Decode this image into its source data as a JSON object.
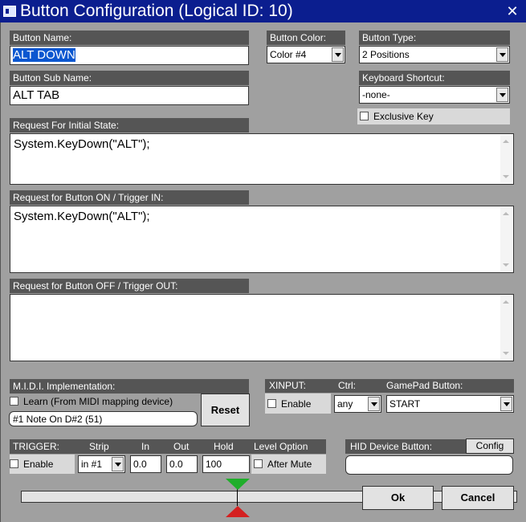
{
  "window": {
    "title": "Button Configuration (Logical ID: 10)"
  },
  "button_name": {
    "label": "Button Name:",
    "value": "ALT DOWN"
  },
  "button_sub_name": {
    "label": "Button Sub Name:",
    "value": "ALT TAB"
  },
  "button_color": {
    "label": "Button Color:",
    "value": "Color #4"
  },
  "button_type": {
    "label": "Button Type:",
    "value": "2 Positions"
  },
  "keyboard_shortcut": {
    "label": "Keyboard Shortcut:",
    "value": "-none-"
  },
  "exclusive_key": {
    "label": "Exclusive Key",
    "checked": false
  },
  "initial_state": {
    "label": "Request For Initial State:",
    "value": "System.KeyDown(\"ALT\");"
  },
  "button_on": {
    "label": "Request for Button ON / Trigger IN:",
    "value": "System.KeyDown(\"ALT\");"
  },
  "button_off": {
    "label": "Request for Button OFF / Trigger OUT:",
    "value": ""
  },
  "midi": {
    "label": "M.I.D.I. Implementation:",
    "learn_label": "Learn (From MIDI mapping device)",
    "learn_checked": false,
    "mapping_value": "#1 Note On D#2 (51)",
    "reset_label": "Reset"
  },
  "xinput": {
    "label": "XINPUT:",
    "ctrl_label": "Ctrl:",
    "gamepad_label": "GamePad Button:",
    "enable_label": "Enable",
    "enable_checked": false,
    "ctrl_value": "any",
    "gamepad_value": "START"
  },
  "trigger": {
    "label": "TRIGGER:",
    "strip_label": "Strip",
    "in_label": "In",
    "out_label": "Out",
    "hold_label": "Hold",
    "level_label": "Level Option",
    "enable_label": "Enable",
    "enable_checked": false,
    "strip_value": "in #1",
    "in_value": "0.0",
    "out_value": "0.0",
    "hold_value": "100",
    "after_mute_label": "After Mute",
    "after_mute_checked": false,
    "level_marker": 0.437,
    "colors": {
      "top_marker": "#1fae2a",
      "bottom_marker": "#d42020"
    }
  },
  "hid": {
    "label": "HID Device Button:",
    "config_label": "Config",
    "value": ""
  },
  "actions": {
    "ok_label": "Ok",
    "cancel_label": "Cancel"
  },
  "colors": {
    "titlebar": "#0b1e8f",
    "background": "#a0a0a0",
    "label_bg": "#555555",
    "selection": "#0b57d0"
  }
}
